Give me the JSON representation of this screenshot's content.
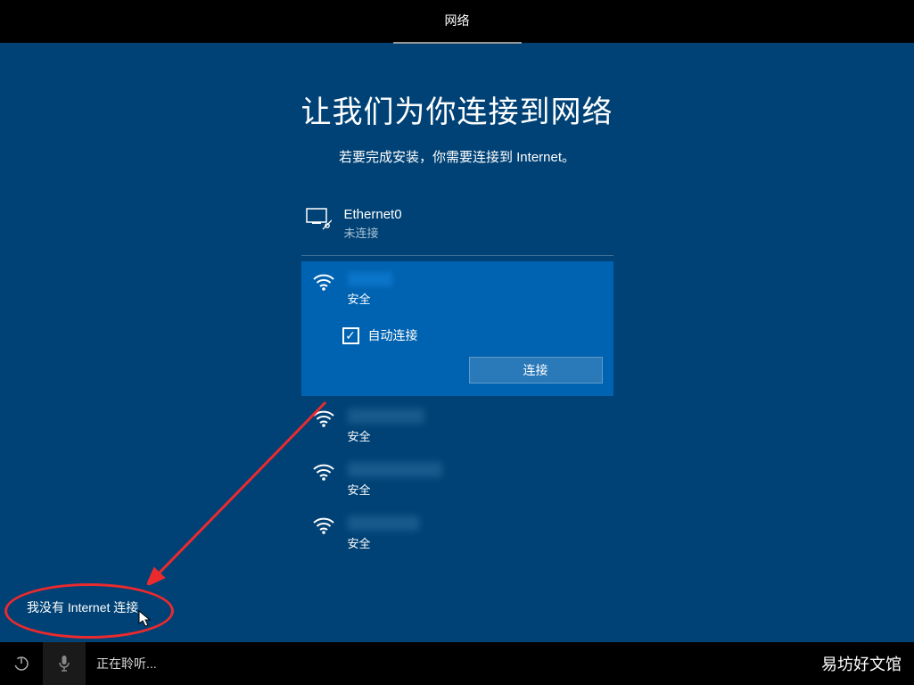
{
  "header": {
    "tab": "网络"
  },
  "page": {
    "title": "让我们为你连接到网络",
    "subtitle": "若要完成安装，你需要连接到 Internet。"
  },
  "ethernet": {
    "name": "Ethernet0",
    "status": "未连接"
  },
  "wifi_selected": {
    "secure": "安全",
    "auto_connect": "自动连接",
    "connect": "连接"
  },
  "wifi_items": [
    {
      "secure": "安全",
      "blur_width": 86
    },
    {
      "secure": "安全",
      "blur_width": 106
    },
    {
      "secure": "安全",
      "blur_width": 80
    }
  ],
  "footer": {
    "no_internet": "我没有 Internet 连接",
    "listening": "正在聆听..."
  },
  "watermark": {
    "main": "易坊好文馆"
  }
}
